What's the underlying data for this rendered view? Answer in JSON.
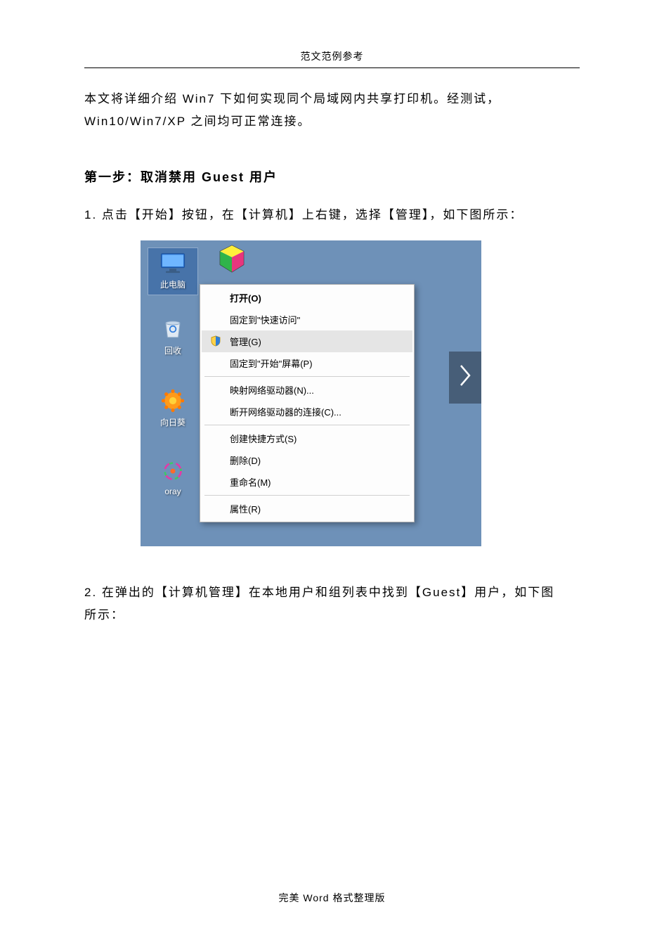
{
  "header": {
    "title": "范文范例参考"
  },
  "intro": {
    "line1": "本文将详细介绍 Win7 下如何实现同个局域网内共享打印机。经测试，",
    "line2": "Win10/Win7/XP 之间均可正常连接。"
  },
  "step1": {
    "title": "第一步：取消禁用 Guest 用户",
    "line": "1. 点击【开始】按钮，在【计算机】上右键，选择【管理】，如下图所示："
  },
  "screenshot": {
    "desktop_icons": {
      "this_pc": "此电脑",
      "recycle": "回收",
      "qq": "向日葵",
      "oray": "oray"
    },
    "context_menu": {
      "open": "打开(O)",
      "pin_quick": "固定到\"快速访问\"",
      "manage": "管理(G)",
      "pin_start": "固定到\"开始\"屏幕(P)",
      "map_drive": "映射网络驱动器(N)...",
      "disconnect_drive": "断开网络驱动器的连接(C)...",
      "create_shortcut": "创建快捷方式(S)",
      "delete": "删除(D)",
      "rename": "重命名(M)",
      "properties": "属性(R)"
    }
  },
  "step2": {
    "line1": "2. 在弹出的【计算机管理】在本地用户和组列表中找到【Guest】用户，如下图",
    "line2": "所示："
  },
  "footer": {
    "text": "完美 Word 格式整理版"
  }
}
